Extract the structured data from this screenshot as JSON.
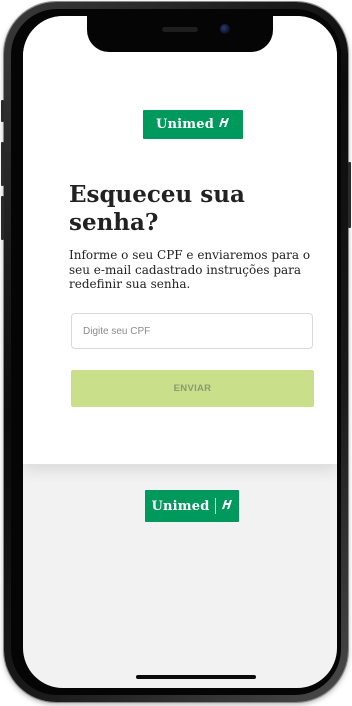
{
  "app": {
    "logo": {
      "text": "Unimed",
      "mark": "ñ"
    }
  },
  "forgot_password": {
    "title_line1": "Esqueceu sua",
    "title_line2": "senha?",
    "description": "Informe o seu CPF e enviaremos para o seu e-mail cadastrado instruções para redefinir sua senha.",
    "cpf_input": {
      "value": "",
      "placeholder": "Digite seu CPF"
    },
    "submit_label": "ENVIAR"
  },
  "footer": {
    "logo": {
      "text": "Unimed",
      "mark": "ñ"
    }
  },
  "colors": {
    "brand_green": "#00995d",
    "button_disabled_bg": "#c9df8a",
    "button_disabled_text": "#8a9a73",
    "text_dark": "#222222",
    "background_gray": "#f2f2f2"
  }
}
